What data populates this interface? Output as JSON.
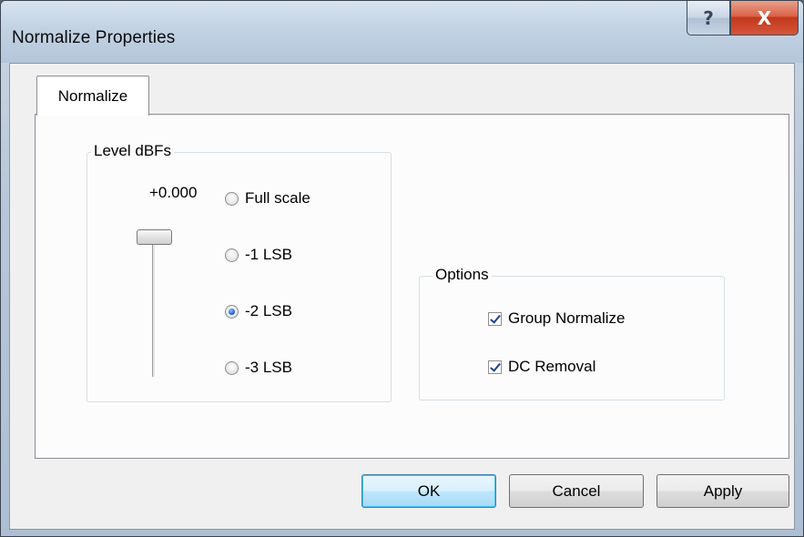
{
  "window": {
    "title": "Normalize Properties",
    "help_glyph": "?",
    "close_glyph": "X"
  },
  "tabs": [
    {
      "label": "Normalize",
      "selected": true
    }
  ],
  "level_group": {
    "label": "Level dBFs",
    "readout": "+0.000",
    "radios": [
      {
        "label": "Full scale",
        "checked": false
      },
      {
        "label": "-1 LSB",
        "checked": false
      },
      {
        "label": "-2 LSB",
        "checked": true
      },
      {
        "label": "-3 LSB",
        "checked": false
      }
    ]
  },
  "options_group": {
    "label": "Options",
    "checkboxes": [
      {
        "label": "Group Normalize",
        "checked": true
      },
      {
        "label": "DC Removal",
        "checked": true
      }
    ]
  },
  "buttons": {
    "ok": "OK",
    "cancel": "Cancel",
    "apply": "Apply"
  },
  "colors": {
    "default_button_border": "#3c7fb1",
    "close_button": "#c3381c",
    "radio_dot": "#1f64c8"
  }
}
